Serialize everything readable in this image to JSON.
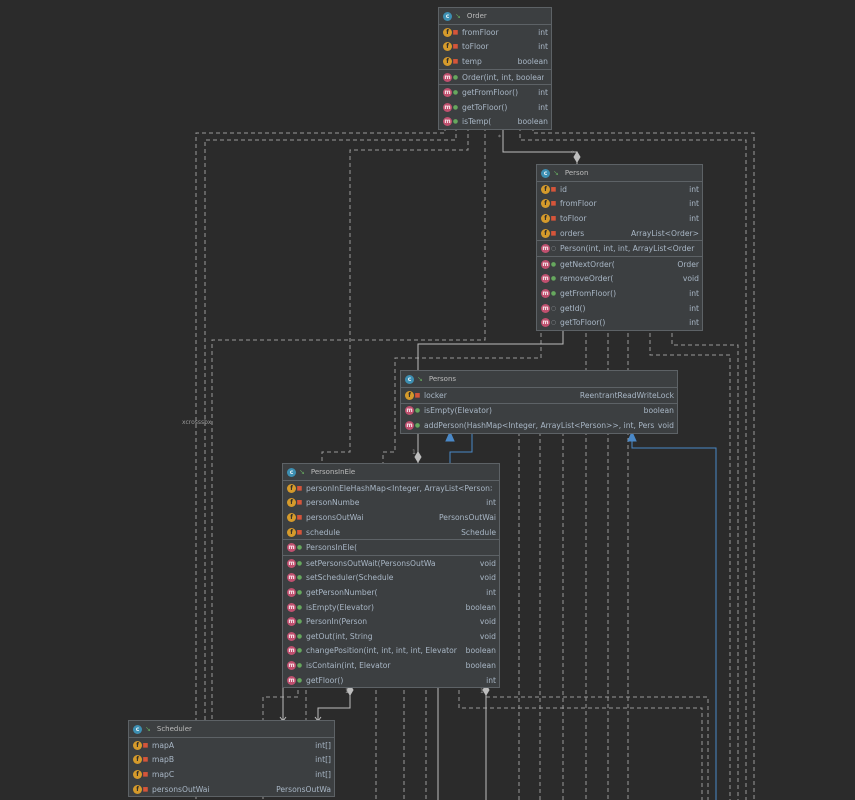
{
  "diagram": {
    "edge_labels": {
      "star_person_orders": "*",
      "star_order_person": "*",
      "one_persons_elevator": "1",
      "one_scheduler_1": "1",
      "one_scheduler_2": "1",
      "side_note": "xcrosssbx"
    },
    "classes": [
      {
        "id": "order",
        "name": "Order",
        "fields": [
          {
            "name": "fromFloor",
            "type": "int"
          },
          {
            "name": "toFloor",
            "type": "int"
          },
          {
            "name": "temp",
            "type": "boolean"
          }
        ],
        "constructors": [
          {
            "name": "Order(int, int, boolean",
            "type": ""
          }
        ],
        "methods": [
          {
            "name": "getFromFloor()",
            "type": "int"
          },
          {
            "name": "getToFloor()",
            "type": "int"
          },
          {
            "name": "isTemp(",
            "type": "boolean"
          }
        ]
      },
      {
        "id": "person",
        "name": "Person",
        "fields": [
          {
            "name": "id",
            "type": "int"
          },
          {
            "name": "fromFloor",
            "type": "int"
          },
          {
            "name": "toFloor",
            "type": "int"
          },
          {
            "name": "orders",
            "type": "ArrayList<Order>"
          }
        ],
        "constructors": [
          {
            "name": "Person(int, int, int, ArrayList<Order>",
            "type": ""
          }
        ],
        "methods": [
          {
            "name": "getNextOrder(",
            "type": "Order"
          },
          {
            "name": "removeOrder(",
            "type": "void"
          },
          {
            "name": "getFromFloor()",
            "type": "int"
          },
          {
            "name": "getId()",
            "type": "int"
          },
          {
            "name": "getToFloor()",
            "type": "int"
          }
        ]
      },
      {
        "id": "persons",
        "name": "Persons",
        "fields": [
          {
            "name": "locker",
            "type": "ReentrantReadWriteLock"
          }
        ],
        "constructors": [],
        "methods": [
          {
            "name": "isEmpty(Elevator)",
            "type": "boolean"
          },
          {
            "name": "addPerson(HashMap<Integer, ArrayList<Person>>, int, Pers",
            "type": "void"
          }
        ]
      },
      {
        "id": "personsinele",
        "name": "PersonsInEle",
        "fields": [
          {
            "name": "personInEleHashMap<Integer, ArrayList<Person>",
            "type": ""
          },
          {
            "name": "personNumbe",
            "type": "int"
          },
          {
            "name": "personsOutWai",
            "type": "PersonsOutWai"
          },
          {
            "name": "schedule",
            "type": "Schedule"
          }
        ],
        "constructors": [
          {
            "name": "PersonsInEle(",
            "type": ""
          }
        ],
        "methods": [
          {
            "name": "setPersonsOutWait(PersonsOutWa",
            "type": "void"
          },
          {
            "name": "setScheduler(Schedule",
            "type": "void"
          },
          {
            "name": "getPersonNumber(",
            "type": "int"
          },
          {
            "name": "isEmpty(Elevator)",
            "type": "boolean"
          },
          {
            "name": "PersonIn(Person",
            "type": "void"
          },
          {
            "name": "getOut(int, String",
            "type": "void"
          },
          {
            "name": "changePosition(int, int, int, int, Elevator",
            "type": "boolean"
          },
          {
            "name": "isContain(int, Elevator",
            "type": "boolean"
          },
          {
            "name": "getFloor()",
            "type": "int"
          }
        ]
      },
      {
        "id": "scheduler",
        "name": "Scheduler",
        "fields": [
          {
            "name": "mapA",
            "type": "int[]"
          },
          {
            "name": "mapB",
            "type": "int[]"
          },
          {
            "name": "mapC",
            "type": "int[]"
          },
          {
            "name": "personsOutWai",
            "type": "PersonsOutWa"
          }
        ],
        "constructors": [],
        "methods": []
      }
    ]
  }
}
